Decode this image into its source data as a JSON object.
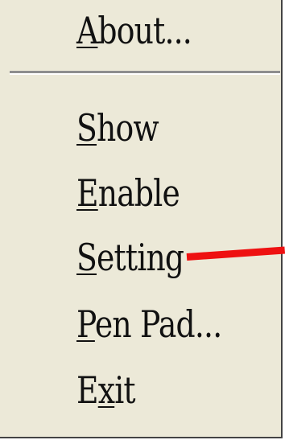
{
  "menu": {
    "items": [
      {
        "mnemonic": "A",
        "rest": "bout..."
      },
      {
        "mnemonic": "S",
        "rest": "how"
      },
      {
        "mnemonic": "E",
        "rest": "nable"
      },
      {
        "mnemonic": "S",
        "rest": "etting"
      },
      {
        "mnemonic": "P",
        "rest": "en Pad..."
      },
      {
        "pre": "E",
        "mnemonic": "x",
        "rest": "it"
      }
    ]
  },
  "colors": {
    "menu_background": "#ece9d8",
    "arrow": "#ee1111"
  }
}
